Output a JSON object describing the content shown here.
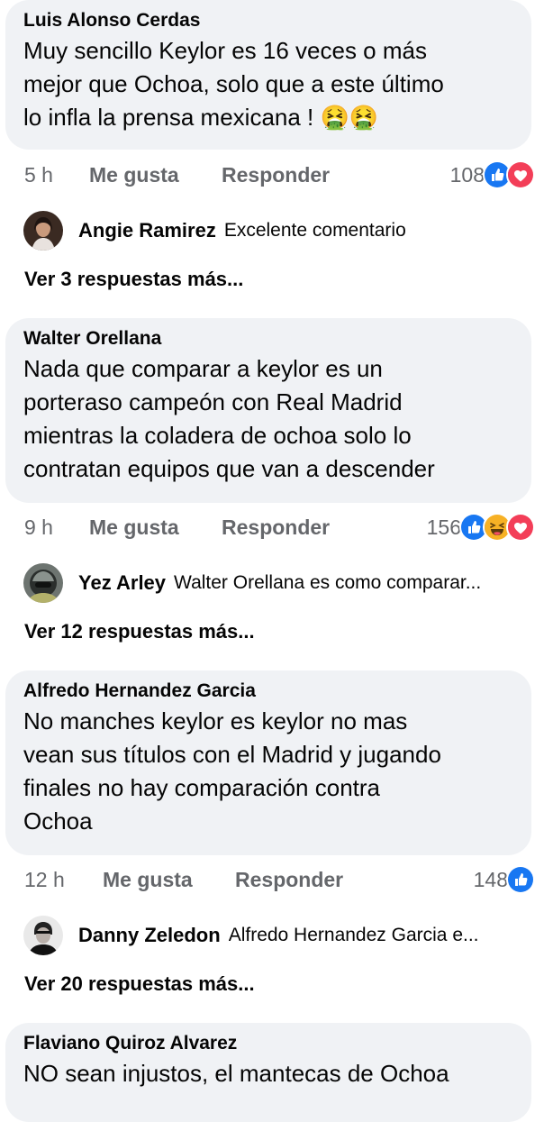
{
  "comments": [
    {
      "author": "Luis Alonso Cerdas",
      "text": "Muy sencillo Keylor es 16 veces o más\nmejor que Ochoa, solo que a este último\nlo infla la prensa mexicana ! 🤮🤮",
      "time": "5 h",
      "like_label": "Me gusta",
      "reply_label": "Responder",
      "reaction_count": "108",
      "reactions": [
        "like-icon",
        "love-icon"
      ],
      "reply_preview": {
        "author": "Angie Ramirez",
        "text": "Excelente comentario",
        "avatar": "avatar-woman"
      },
      "more_replies": "Ver 3 respuestas más..."
    },
    {
      "author": "Walter Orellana",
      "text": "Nada que comparar a keylor es un\nporteraso campeón con Real Madrid\nmientras la coladera de ochoa solo lo\ncontratan equipos que van a descender",
      "time": "9 h",
      "like_label": "Me gusta",
      "reply_label": "Responder",
      "reaction_count": "156",
      "reactions": [
        "like-icon",
        "haha-icon",
        "love-icon"
      ],
      "reply_preview": {
        "author": "Yez Arley",
        "text": "Walter Orellana es como comparar...",
        "avatar": "avatar-helmet"
      },
      "more_replies": "Ver 12 respuestas más..."
    },
    {
      "author": "Alfredo Hernandez Garcia",
      "text": "No manches keylor es keylor no mas\nvean sus títulos  con el Madrid y jugando\nfinales no hay comparación  contra\nOchoa",
      "time": "12 h",
      "like_label": "Me gusta",
      "reply_label": "Responder",
      "reaction_count": "148",
      "reactions": [
        "like-icon"
      ],
      "reply_preview": {
        "author": "Danny Zeledon",
        "text": "Alfredo Hernandez Garcia e...",
        "avatar": "avatar-man"
      },
      "more_replies": "Ver 20 respuestas más..."
    },
    {
      "author": "Flaviano Quiroz Alvarez",
      "text": "NO sean injustos, el mantecas de Ochoa"
    }
  ],
  "colors": {
    "bubble": "#f0f2f5",
    "meta": "#65676b",
    "like": "#1877f2",
    "love": "#f33e58",
    "haha": "#f7b125"
  }
}
